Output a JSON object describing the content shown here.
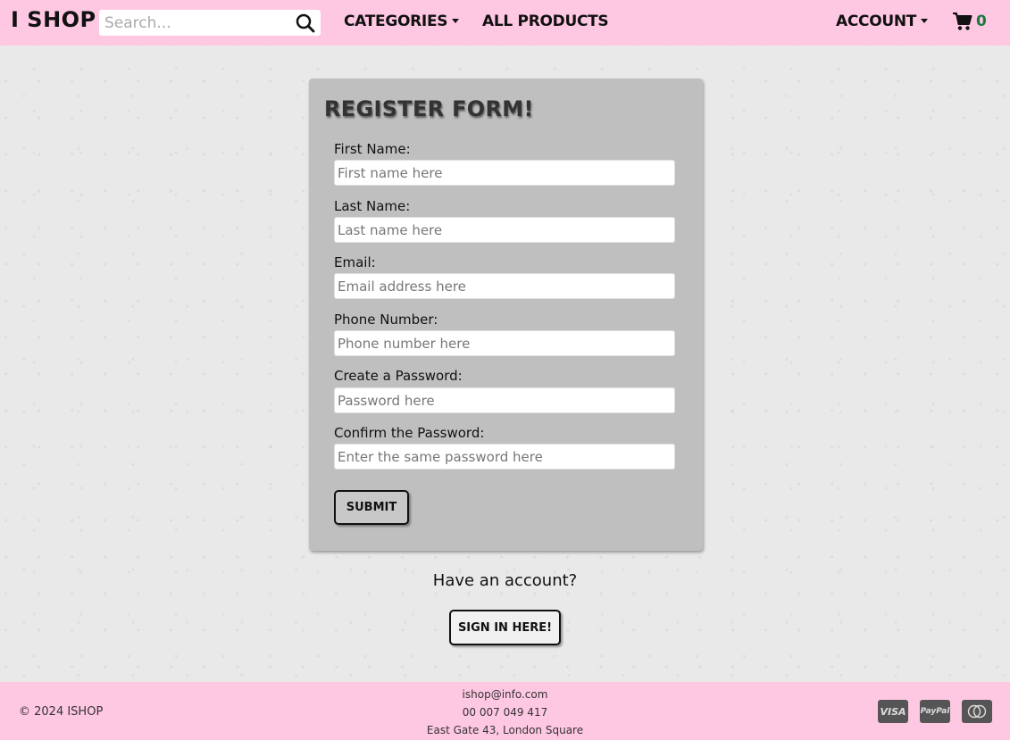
{
  "header": {
    "brand": "I SHOP",
    "search_placeholder": "Search...",
    "nav": {
      "categories": "CATEGORIES",
      "all_products": "ALL PRODUCTS",
      "account": "ACCOUNT"
    },
    "cart_count": "0"
  },
  "form": {
    "title": "REGISTER FORM!",
    "fields": [
      {
        "label": "First Name:",
        "placeholder": "First name here"
      },
      {
        "label": "Last Name:",
        "placeholder": "Last name here"
      },
      {
        "label": "Email:",
        "placeholder": "Email address here"
      },
      {
        "label": "Phone Number:",
        "placeholder": "Phone number here"
      },
      {
        "label": "Create a Password:",
        "placeholder": "Password here"
      },
      {
        "label": "Confirm the Password:",
        "placeholder": "Enter the same password here"
      }
    ],
    "submit_label": "SUBMIT"
  },
  "signin": {
    "prompt": "Have an account?",
    "button_label": "SIGN IN HERE!"
  },
  "footer": {
    "copyright": "© 2024 ISHOP",
    "email": "ishop@info.com",
    "phone": "00 007 049 417",
    "address": "East Gate 43, London Square",
    "payments": {
      "visa": "VISA",
      "paypal": "PayPal"
    }
  },
  "colors": {
    "header_bg": "#ffc8e2",
    "card_bg": "#bfbfbf",
    "cart_count": "#1a7a3f"
  },
  "icons": [
    "search-icon",
    "cart-icon",
    "mastercard-icon"
  ]
}
